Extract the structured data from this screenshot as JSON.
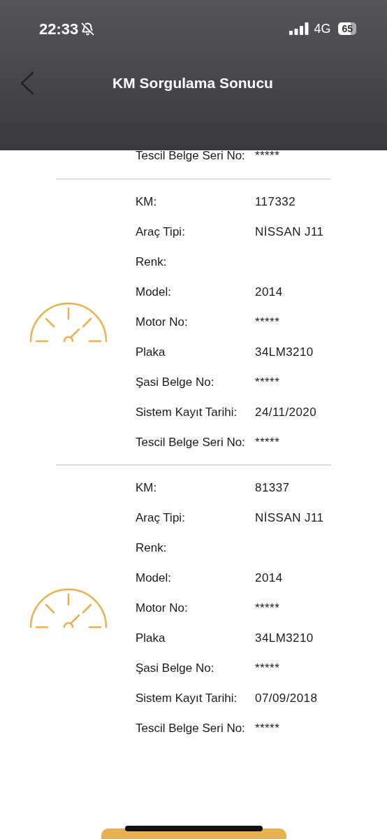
{
  "status_bar": {
    "time": "22:33",
    "network": "4G",
    "battery": "65"
  },
  "header": {
    "title": "KM Sorgulama Sonucu"
  },
  "partial_row": {
    "label": "Tescil Belge Seri No:",
    "value": "*****"
  },
  "records": [
    {
      "rows": [
        {
          "label": "KM:",
          "value": "117332"
        },
        {
          "label": "Araç Tipi:",
          "value": "NİSSAN J11"
        },
        {
          "label": "Renk:"
        },
        {
          "label": "Model:",
          "value": "2014"
        },
        {
          "label": "Motor No:",
          "value": "*****"
        },
        {
          "label": "Plaka",
          "value": "34LM3210"
        },
        {
          "label": "Şasi Belge No:",
          "value": "*****"
        },
        {
          "label": "Sistem Kayıt Tarihi:",
          "value": "24/11/2020"
        },
        {
          "label": "Tescil Belge Seri No:",
          "value": "*****"
        }
      ]
    },
    {
      "rows": [
        {
          "label": "KM:",
          "value": "81337"
        },
        {
          "label": "Araç Tipi:",
          "value": "NİSSAN J11"
        },
        {
          "label": "Renk:"
        },
        {
          "label": "Model:",
          "value": "2014"
        },
        {
          "label": "Motor No:",
          "value": "*****"
        },
        {
          "label": "Plaka",
          "value": "34LM3210"
        },
        {
          "label": "Şasi Belge No:",
          "value": "*****"
        },
        {
          "label": "Sistem Kayıt Tarihi:",
          "value": "07/09/2018"
        },
        {
          "label": "Tescil Belge Seri No:",
          "value": "*****"
        }
      ]
    }
  ]
}
